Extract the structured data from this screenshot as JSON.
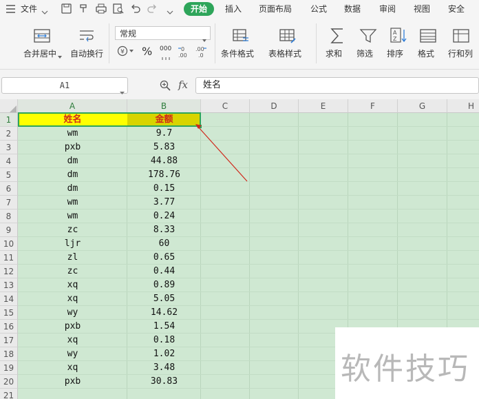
{
  "menu": {
    "file_label": "文件",
    "tabs": [
      "开始",
      "插入",
      "页面布局",
      "公式",
      "数据",
      "审阅",
      "视图",
      "安全"
    ]
  },
  "ribbon": {
    "merge_center": "合并居中",
    "wrap_text": "自动换行",
    "number_format": "常规",
    "percent": "%",
    "thousands": "000",
    "conditional_format": "条件格式",
    "table_style": "表格样式",
    "sum": "求和",
    "filter": "筛选",
    "sort": "排序",
    "format": "格式",
    "rows_cols": "行和列"
  },
  "formula_bar": {
    "name_box": "A1",
    "fx_label": "fx",
    "content": "姓名"
  },
  "sheet": {
    "columns": [
      "A",
      "B",
      "C",
      "D",
      "E",
      "F",
      "G",
      "H"
    ],
    "row_numbers": [
      "1",
      "2",
      "3",
      "4",
      "5",
      "6",
      "7",
      "8",
      "9",
      "10",
      "11",
      "12",
      "13",
      "14",
      "15",
      "16",
      "17",
      "18",
      "19",
      "20",
      "21"
    ],
    "header": [
      "姓名",
      "金额"
    ],
    "rows": [
      [
        "wm",
        "9.7"
      ],
      [
        "pxb",
        "5.83"
      ],
      [
        "dm",
        "44.88"
      ],
      [
        "dm",
        "178.76"
      ],
      [
        "dm",
        "0.15"
      ],
      [
        "wm",
        "3.77"
      ],
      [
        "wm",
        "0.24"
      ],
      [
        "zc",
        "8.33"
      ],
      [
        "ljr",
        "60"
      ],
      [
        "zl",
        "0.65"
      ],
      [
        "zc",
        "0.44"
      ],
      [
        "xq",
        "0.89"
      ],
      [
        "xq",
        "5.05"
      ],
      [
        "wy",
        "14.62"
      ],
      [
        "pxb",
        "1.54"
      ],
      [
        "xq",
        "0.18"
      ],
      [
        "wy",
        "1.02"
      ],
      [
        "xq",
        "3.48"
      ],
      [
        "pxb",
        "30.83"
      ]
    ]
  },
  "colors": {
    "accent_green": "#2ea55a",
    "grid_background": "#cfe8d2",
    "header_fill": "#ffff00",
    "header_text": "#d0281b",
    "annotation_arrow": "#d0281b"
  },
  "watermark": "软件技巧"
}
